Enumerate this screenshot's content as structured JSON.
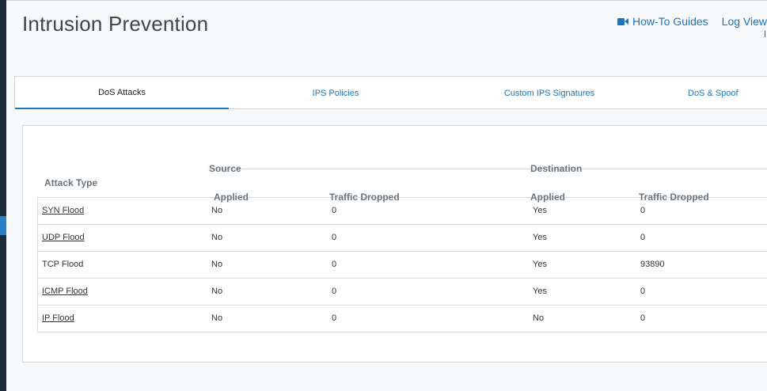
{
  "page": {
    "title": "Intrusion Prevention"
  },
  "top_links": {
    "howto": {
      "label": "How-To Guides",
      "icon": "video-camera-icon"
    },
    "logview": {
      "label": "Log View"
    }
  },
  "tabs": [
    {
      "label": "DoS Attacks",
      "active": true
    },
    {
      "label": "IPS Policies",
      "active": false
    },
    {
      "label": "Custom IPS Signatures",
      "active": false
    },
    {
      "label": "DoS & Spoof",
      "active": false
    }
  ],
  "table": {
    "attack_type_header": "Attack Type",
    "source_header": "Source",
    "destination_header": "Destination",
    "applied_header": "Applied",
    "dropped_header": "Traffic Dropped",
    "rows": [
      {
        "attack": "SYN Flood",
        "link": true,
        "src_applied": "No",
        "src_dropped": "0",
        "dst_applied": "Yes",
        "dst_dropped": "0"
      },
      {
        "attack": "UDP Flood",
        "link": true,
        "src_applied": "No",
        "src_dropped": "0",
        "dst_applied": "Yes",
        "dst_dropped": "0"
      },
      {
        "attack": "TCP Flood",
        "link": false,
        "src_applied": "No",
        "src_dropped": "0",
        "dst_applied": "Yes",
        "dst_dropped": "93890"
      },
      {
        "attack": "ICMP Flood",
        "link": true,
        "src_applied": "No",
        "src_dropped": "0",
        "dst_applied": "Yes",
        "dst_dropped": "0"
      },
      {
        "attack": "IP Flood",
        "link": true,
        "src_applied": "No",
        "src_dropped": "0",
        "dst_applied": "No",
        "dst_dropped": "0"
      }
    ]
  },
  "colors": {
    "accent": "#1c75bc",
    "sidebar": "#1b2b3c"
  }
}
